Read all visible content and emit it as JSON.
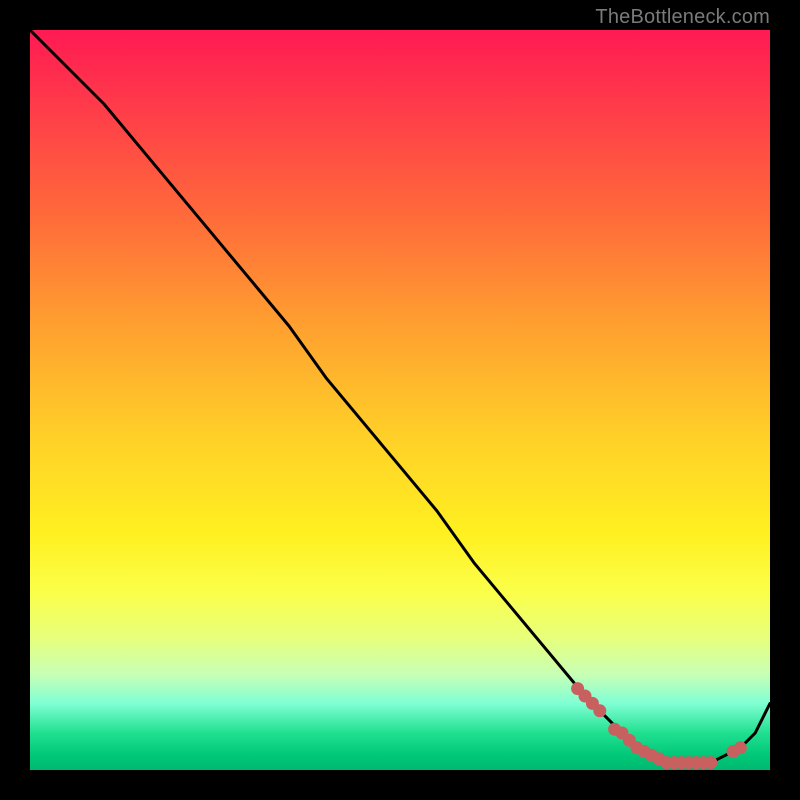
{
  "attribution": "TheBottleneck.com",
  "colors": {
    "background": "#000000",
    "gradient_top": "#ff1a53",
    "gradient_mid": "#ffd028",
    "gradient_bottom": "#00b870",
    "curve": "#000000",
    "markers": "#c86060"
  },
  "chart_data": {
    "type": "line",
    "title": "",
    "xlabel": "",
    "ylabel": "",
    "xlim": [
      0,
      100
    ],
    "ylim": [
      0,
      100
    ],
    "series": [
      {
        "name": "bottleneck-curve",
        "x": [
          0,
          5,
          10,
          15,
          20,
          25,
          30,
          35,
          40,
          45,
          50,
          55,
          60,
          65,
          70,
          75,
          78,
          80,
          82,
          84,
          86,
          88,
          90,
          92,
          94,
          96,
          98,
          100
        ],
        "values": [
          100,
          95,
          90,
          84,
          78,
          72,
          66,
          60,
          53,
          47,
          41,
          35,
          28,
          22,
          16,
          10,
          7,
          5,
          3,
          2,
          1,
          1,
          1,
          1,
          2,
          3,
          5,
          9
        ]
      }
    ],
    "markers": {
      "name": "highlighted-points",
      "x": [
        74,
        75,
        76,
        77,
        79,
        80,
        81,
        82,
        83,
        84,
        85,
        86,
        87,
        88,
        89,
        90,
        91,
        92,
        95,
        96
      ],
      "values": [
        11,
        10,
        9,
        8,
        5.5,
        5,
        4,
        3,
        2.5,
        2,
        1.5,
        1,
        1,
        1,
        1,
        1,
        1,
        1,
        2.5,
        3
      ]
    }
  }
}
